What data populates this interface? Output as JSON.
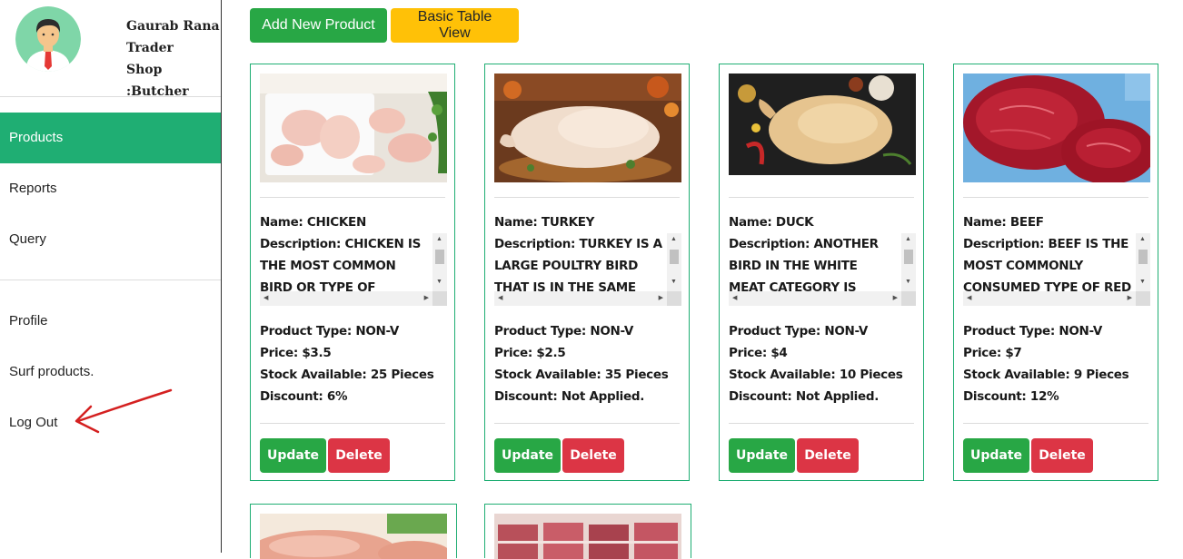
{
  "user": {
    "name": "Gaurab Rana",
    "role": "Trader",
    "shop": "Shop :Butcher"
  },
  "nav": {
    "top": [
      {
        "label": "Products",
        "active": true
      },
      {
        "label": "Reports",
        "active": false
      },
      {
        "label": "Query",
        "active": false
      }
    ],
    "bottom": [
      {
        "label": "Profile"
      },
      {
        "label": "Surf products."
      },
      {
        "label": "Log Out"
      }
    ]
  },
  "toolbar": {
    "add_label": "Add New Product",
    "table_label": "Basic Table View"
  },
  "products": [
    {
      "name": "Name: CHICKEN",
      "description": "Description: CHICKEN IS THE MOST COMMON BIRD OR TYPE OF POULTRY THAT IS",
      "type": "Product Type: NON-V",
      "price": "Price: $3.5",
      "stock": "Stock Available: 25 Pieces",
      "discount": "Discount: 6%",
      "update_label": "Update",
      "delete_label": "Delete"
    },
    {
      "name": "Name: TURKEY",
      "description": "Description: TURKEY IS A LARGE POULTRY BIRD THAT IS IN THE SAME WHITE",
      "type": "Product Type: NON-V",
      "price": "Price: $2.5",
      "stock": "Stock Available: 35 Pieces",
      "discount": "Discount: Not Applied.",
      "update_label": "Update",
      "delete_label": "Delete"
    },
    {
      "name": "Name: DUCK",
      "description": "Description: ANOTHER BIRD IN THE WHITE MEAT CATEGORY IS DUCK, EVEN",
      "type": "Product Type: NON-V",
      "price": "Price: $4",
      "stock": "Stock Available: 10 Pieces",
      "discount": "Discount: Not Applied.",
      "update_label": "Update",
      "delete_label": "Delete"
    },
    {
      "name": "Name: BEEF",
      "description": "Description: BEEF IS THE MOST COMMONLY CONSUMED TYPE OF RED",
      "type": "Product Type: NON-V",
      "price": "Price: $7",
      "stock": "Stock Available: 9 Pieces",
      "discount": "Discount: 12%",
      "update_label": "Update",
      "delete_label": "Delete"
    }
  ],
  "colors": {
    "accent": "#1fae73",
    "success": "#28a745",
    "warning": "#ffc107",
    "danger": "#dc3545",
    "annotation_arrow": "#d42020"
  }
}
